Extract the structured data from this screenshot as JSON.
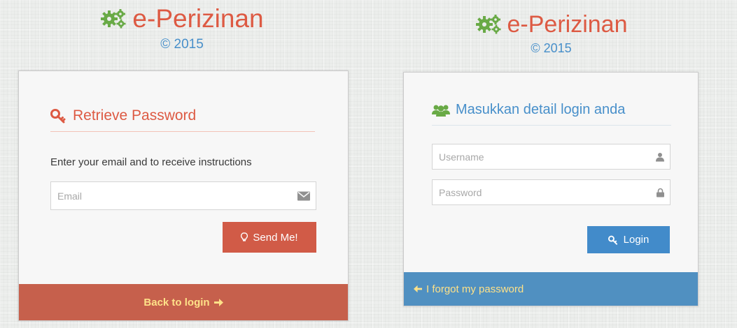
{
  "colors": {
    "brand_red": "#dd5a43",
    "brand_blue": "#478fca",
    "gear_green": "#69aa46",
    "toolbar_red": "#c6604c",
    "toolbar_blue": "#5090c1",
    "toolbar_yellow": "#fee188",
    "send_button": "#d15b47",
    "login_button": "#428bca"
  },
  "left_panel": {
    "brand": {
      "title": "e-Perizinan",
      "year": "© 2015",
      "icon": "gears-icon"
    },
    "header": {
      "icon": "key-icon",
      "title": "Retrieve Password"
    },
    "instructions": "Enter your email and to receive instructions",
    "email": {
      "placeholder": "Email",
      "icon": "envelope-icon"
    },
    "send_button": {
      "icon": "lightbulb-icon",
      "label": "Send Me!"
    },
    "back_link": {
      "label": "Back to login",
      "icon": "arrow-right-icon"
    }
  },
  "right_panel": {
    "brand": {
      "title": "e-Perizinan",
      "year": "© 2015",
      "icon": "gears-icon"
    },
    "header": {
      "icon": "users-icon",
      "title": "Masukkan detail login anda"
    },
    "username": {
      "placeholder": "Username",
      "icon": "user-icon"
    },
    "password": {
      "placeholder": "Password",
      "icon": "lock-icon"
    },
    "login_button": {
      "icon": "key-icon",
      "label": "Login"
    },
    "forgot_link": {
      "label": "I forgot my password",
      "icon": "arrow-left-icon"
    }
  }
}
